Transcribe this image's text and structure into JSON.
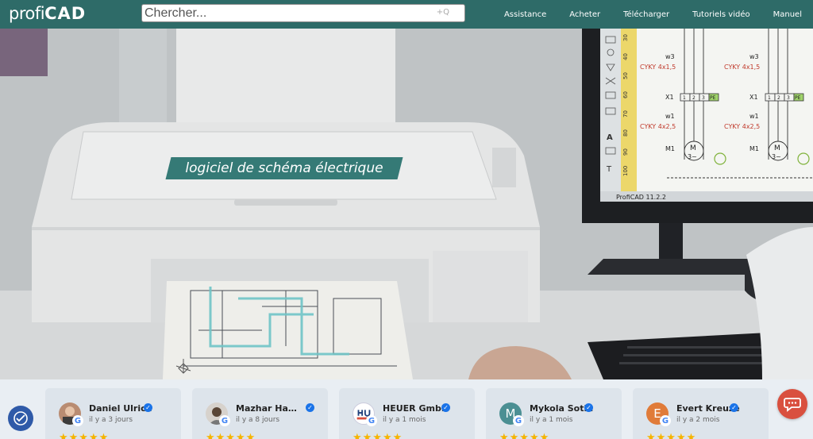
{
  "header": {
    "logo_part1": "profi",
    "logo_part2": "CAD",
    "search_placeholder": "Chercher...",
    "search_icon_glyph": "+Q",
    "nav": [
      {
        "label": "Assistance"
      },
      {
        "label": "Acheter"
      },
      {
        "label": "Télécharger"
      },
      {
        "label": "Tutoriels vidéo"
      },
      {
        "label": "Manuel"
      }
    ]
  },
  "hero": {
    "tagline": "logiciel de schéma électrique",
    "screen": {
      "labels": [
        "w3",
        "CYKY 4x1,5",
        "X1",
        "w1",
        "CYKY 4x2,5",
        "M1",
        "w3",
        "CYKY 4x1,5",
        "X1",
        "w1",
        "CYKY 4x2,5",
        "M1"
      ],
      "terminals": [
        "1",
        "2",
        "3",
        "PE"
      ],
      "motor_label": "M",
      "motor_sub": "3~",
      "ruler_marks": [
        "30",
        "40",
        "50",
        "60",
        "70",
        "80",
        "90",
        "100"
      ],
      "tool_glyphs": [
        "A",
        "T"
      ],
      "status": "ProfiCAD 11.2.2"
    }
  },
  "reviews": [
    {
      "name": "Daniel Ulrich",
      "time": "il y a 3 jours",
      "initial": "",
      "avatar_color": "#b98c72",
      "stars": 5
    },
    {
      "name": "Mazhar Hamm...",
      "time": "il y a 8 jours",
      "initial": "",
      "avatar_color": "#8a7c6e",
      "stars": 5
    },
    {
      "name": "HEUER GmbH",
      "time": "il y a 1 mois",
      "initial": "",
      "avatar_color": "#1f3f7a",
      "stars": 5
    },
    {
      "name": "Mykola Sotin",
      "time": "il y a 1 mois",
      "initial": "M",
      "avatar_color": "#4b8f93",
      "stars": 5
    },
    {
      "name": "Evert Kreuze",
      "time": "il y a 2 mois",
      "initial": "E",
      "avatar_color": "#e07b39",
      "stars": 5
    }
  ],
  "colors": {
    "brand": "#2e6b68",
    "tagline_bg": "#357a76",
    "verified": "#1a73e8",
    "star": "#f5b400",
    "chat": "#d9503f"
  }
}
